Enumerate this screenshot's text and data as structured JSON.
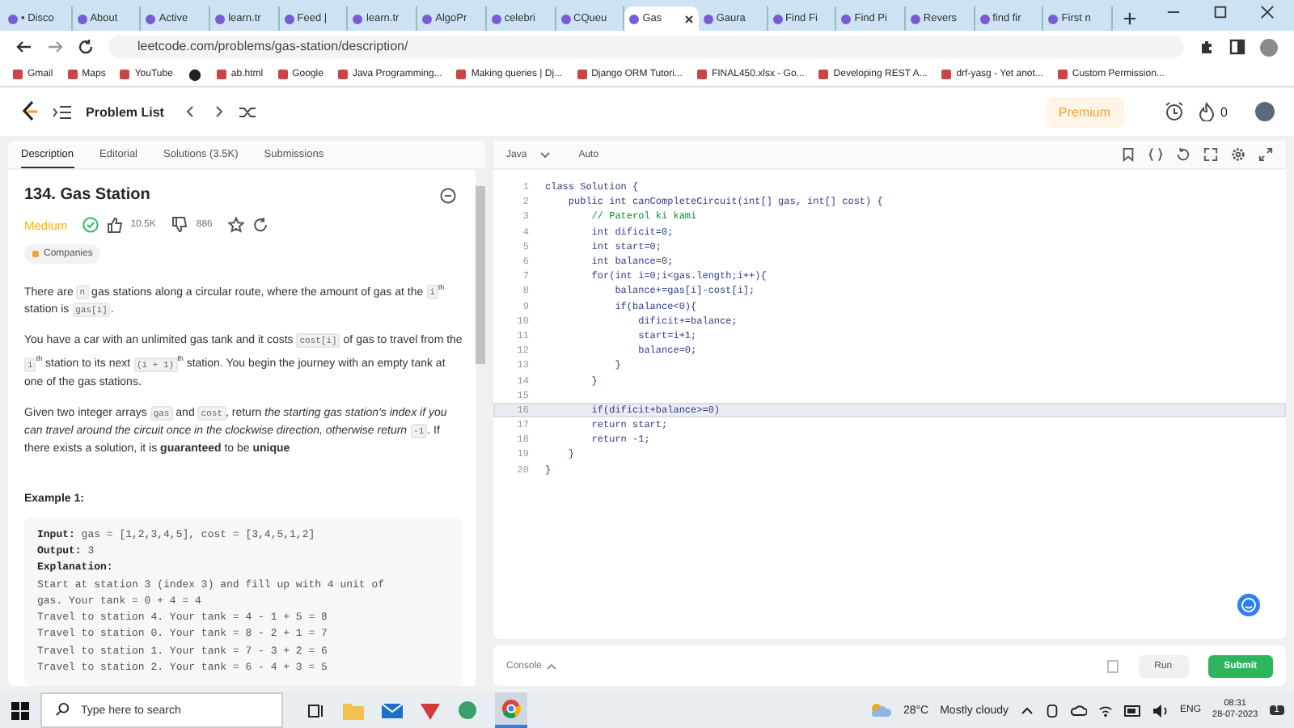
{
  "browser": {
    "tabs": [
      {
        "label": "• Disco",
        "selected": false
      },
      {
        "label": "About",
        "selected": false
      },
      {
        "label": "Active",
        "selected": false
      },
      {
        "label": "learn.tr",
        "selected": false
      },
      {
        "label": "Feed |",
        "selected": false
      },
      {
        "label": "learn.tr",
        "selected": false
      },
      {
        "label": "AlgoPr",
        "selected": false
      },
      {
        "label": "celebri",
        "selected": false
      },
      {
        "label": "CQueu",
        "selected": false
      },
      {
        "label": "Gas",
        "selected": true
      },
      {
        "label": "Gaura",
        "selected": false
      },
      {
        "label": "Find Fi",
        "selected": false
      },
      {
        "label": "Find Pi",
        "selected": false
      },
      {
        "label": "Revers",
        "selected": false
      },
      {
        "label": "find fir",
        "selected": false
      },
      {
        "label": "First n",
        "selected": false
      }
    ],
    "url": "leetcode.com/problems/gas-station/description/",
    "bookmarks": [
      {
        "kind": "link",
        "label": "Gmail"
      },
      {
        "kind": "link",
        "label": "Maps"
      },
      {
        "kind": "link",
        "label": "YouTube"
      },
      {
        "kind": "icon"
      },
      {
        "kind": "link",
        "label": "ab.html"
      },
      {
        "kind": "link",
        "label": "Google"
      },
      {
        "kind": "link",
        "label": "Java Programming..."
      },
      {
        "kind": "link",
        "label": "Making queries | Dj..."
      },
      {
        "kind": "link",
        "label": "Django ORM Tutori..."
      },
      {
        "kind": "link",
        "label": "FINAL450.xlsx - Go..."
      },
      {
        "kind": "link",
        "label": "Developing REST A..."
      },
      {
        "kind": "link",
        "label": "drf-yasg - Yet anot..."
      },
      {
        "kind": "link",
        "label": "Custom Permission..."
      }
    ]
  },
  "header": {
    "problem_list": "Problem List",
    "premium": "Premium",
    "streak": "0"
  },
  "panel_tabs": [
    {
      "label": "Description",
      "selected": true
    },
    {
      "label": "Editorial",
      "selected": false
    },
    {
      "label": "Solutions (3.5K)",
      "selected": false
    },
    {
      "label": "Submissions",
      "selected": false
    }
  ],
  "problem": {
    "title": "134. Gas Station",
    "difficulty": "Medium",
    "solved": true,
    "likes": "10.5K",
    "dislikes": "886",
    "companies": "Companies",
    "paragraphs": [
      [
        {
          "kind": "text",
          "t": "There are "
        },
        {
          "kind": "code",
          "t": "n"
        },
        {
          "kind": "text",
          "t": " gas stations along a circular route, where the amount of gas at the "
        },
        {
          "kind": "code",
          "t": "i"
        },
        {
          "kind": "sup",
          "t": "th"
        },
        {
          "kind": "text",
          "t": " station is "
        },
        {
          "kind": "code",
          "t": "gas[i]"
        },
        {
          "kind": "text",
          "t": "."
        }
      ],
      [
        {
          "kind": "text",
          "t": "You have a car with an unlimited gas tank and it costs "
        },
        {
          "kind": "code",
          "t": "cost[i]"
        },
        {
          "kind": "text",
          "t": " of gas to travel from the "
        },
        {
          "kind": "code",
          "t": "i"
        },
        {
          "kind": "sup",
          "t": "th"
        },
        {
          "kind": "text",
          "t": " station to its next "
        },
        {
          "kind": "code",
          "t": "(i + 1)"
        },
        {
          "kind": "sup",
          "t": "th"
        },
        {
          "kind": "text",
          "t": " station. You begin the journey with an empty tank at one of the gas stations."
        }
      ],
      [
        {
          "kind": "text",
          "t": "Given two integer arrays "
        },
        {
          "kind": "code",
          "t": "gas"
        },
        {
          "kind": "text",
          "t": " and "
        },
        {
          "kind": "code",
          "t": "cost"
        },
        {
          "kind": "text",
          "t": ", return "
        },
        {
          "kind": "em",
          "t": "the starting gas station's index if you can travel around the circuit once in the clockwise direction, otherwise return "
        },
        {
          "kind": "code",
          "t": "-1"
        },
        {
          "kind": "text",
          "t": ". If there exists a solution, it is "
        },
        {
          "kind": "strong",
          "t": "guaranteed"
        },
        {
          "kind": "text",
          "t": " to be "
        },
        {
          "kind": "strong",
          "t": "unique"
        }
      ]
    ],
    "example_title": "Example 1:",
    "example_lines": [
      {
        "label": "Input:",
        "text": " gas = [1,2,3,4,5], cost = [3,4,5,1,2]"
      },
      {
        "label": "Output:",
        "text": " 3"
      },
      {
        "label": "Explanation:"
      },
      {
        "text": "Start at station 3 (index 3) and fill up with 4 unit of"
      },
      {
        "text": "gas. Your tank = 0 + 4 = 4"
      },
      {
        "text": "Travel to station 4. Your tank = 4 - 1 + 5 = 8"
      },
      {
        "text": "Travel to station 0. Your tank = 8 - 2 + 1 = 7"
      },
      {
        "text": "Travel to station 1. Your tank = 7 - 3 + 2 = 6"
      },
      {
        "text": "Travel to station 2. Your tank = 6 - 4 + 3 = 5"
      }
    ]
  },
  "editor": {
    "language": "Java",
    "mode": "Auto",
    "lines": [
      {
        "n": "1",
        "kind": "code",
        "active": false,
        "t": "class Solution {"
      },
      {
        "n": "2",
        "kind": "code",
        "active": false,
        "t": "    public int canCompleteCircuit(int[] gas, int[] cost) {"
      },
      {
        "n": "3",
        "kind": "comment",
        "active": false,
        "t": "        // Paterol ki kami"
      },
      {
        "n": "4",
        "kind": "code",
        "active": false,
        "t": "        int dificit=0;"
      },
      {
        "n": "5",
        "kind": "code",
        "active": false,
        "t": "        int start=0;"
      },
      {
        "n": "6",
        "kind": "code",
        "active": false,
        "t": "        int balance=0;"
      },
      {
        "n": "7",
        "kind": "code",
        "active": false,
        "t": "        for(int i=0;i<gas.length;i++){"
      },
      {
        "n": "8",
        "kind": "code",
        "active": false,
        "t": "            balance+=gas[i]-cost[i];"
      },
      {
        "n": "9",
        "kind": "code",
        "active": false,
        "t": "            if(balance<0){"
      },
      {
        "n": "10",
        "kind": "code",
        "active": false,
        "t": "                dificit+=balance;"
      },
      {
        "n": "11",
        "kind": "code",
        "active": false,
        "t": "                start=i+1;"
      },
      {
        "n": "12",
        "kind": "code",
        "active": false,
        "t": "                balance=0;"
      },
      {
        "n": "13",
        "kind": "code",
        "active": false,
        "t": "            }"
      },
      {
        "n": "14",
        "kind": "code",
        "active": false,
        "t": "        }"
      },
      {
        "n": "15",
        "kind": "blank",
        "active": false
      },
      {
        "n": "16",
        "kind": "code",
        "active": true,
        "t": "        if(dificit+balance>=0)"
      },
      {
        "n": "17",
        "kind": "code",
        "active": false,
        "t": "        return start;"
      },
      {
        "n": "18",
        "kind": "code",
        "active": false,
        "t": "        return -1;"
      },
      {
        "n": "19",
        "kind": "code",
        "active": false,
        "t": "    }"
      },
      {
        "n": "20",
        "kind": "code",
        "active": false,
        "t": "}"
      }
    ]
  },
  "console": {
    "label": "Console",
    "run": "Run",
    "submit": "Submit"
  },
  "taskbar": {
    "search_placeholder": "Type here to search",
    "temperature": "28°C",
    "weather": "Mostly cloudy",
    "language": "ENG",
    "time": "08:31",
    "date": "28-07-2023",
    "notifications": "1"
  }
}
